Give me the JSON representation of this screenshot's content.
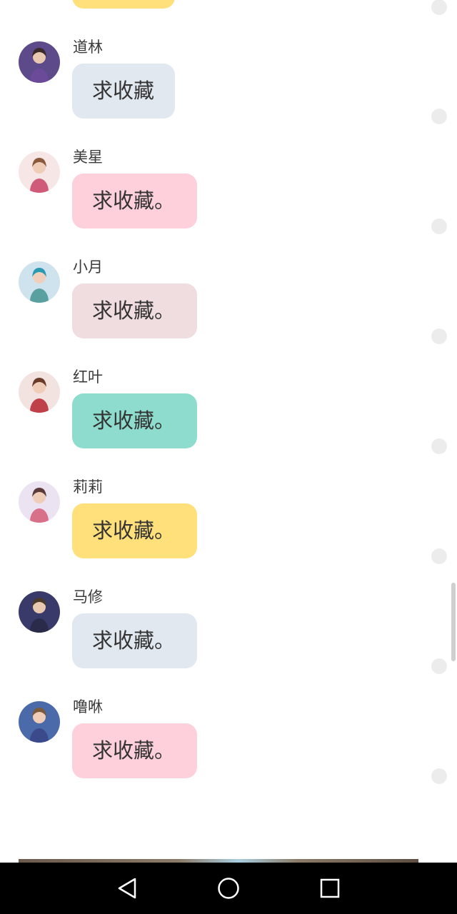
{
  "top_partial": {
    "bubble_color": "#ffe07a"
  },
  "messages": [
    {
      "name": "道林",
      "text": "求收藏",
      "bubble_color": "#e1e8f0",
      "bubble_width": 144,
      "avatar": {
        "bg": "#5c4a8a",
        "skin": "#e8c8b0",
        "hair": "#3a2a2a",
        "cloth": "#6b4a9a"
      }
    },
    {
      "name": "美星",
      "text": "求收藏。",
      "bubble_color": "#fdd0dc",
      "bubble_width": 175,
      "avatar": {
        "bg": "#f7e6e6",
        "skin": "#f0cdb8",
        "hair": "#8a5a3a",
        "cloth": "#d05a7a"
      }
    },
    {
      "name": "小月",
      "text": "求收藏。",
      "bubble_color": "#f0dde0",
      "bubble_width": 175,
      "avatar": {
        "bg": "#cfe3ee",
        "skin": "#f0d0bc",
        "hair": "#2a9ab0",
        "cloth": "#5aa0a0"
      }
    },
    {
      "name": "红叶",
      "text": "求收藏。",
      "bubble_color": "#8ddcce",
      "bubble_width": 175,
      "avatar": {
        "bg": "#f3e3e0",
        "skin": "#efcdb8",
        "hair": "#6a3a2a",
        "cloth": "#c0404a"
      }
    },
    {
      "name": "莉莉",
      "text": "求收藏。",
      "bubble_color": "#ffe07a",
      "bubble_width": 175,
      "avatar": {
        "bg": "#ebe3f2",
        "skin": "#f0cdb8",
        "hair": "#5a3a3a",
        "cloth": "#d8708a"
      }
    },
    {
      "name": "马修",
      "text": "求收藏。",
      "bubble_color": "#e1e8f0",
      "bubble_width": 175,
      "avatar": {
        "bg": "#3a3a6a",
        "skin": "#e8c8b0",
        "hair": "#4a3a2a",
        "cloth": "#2a2a4a"
      }
    },
    {
      "name": "噜咻",
      "text": "求收藏。",
      "bubble_color": "#fdd0dc",
      "bubble_width": 175,
      "avatar": {
        "bg": "#4a6aaa",
        "skin": "#efcdb8",
        "hair": "#7a5a3a",
        "cloth": "#3a4a8a"
      }
    }
  ],
  "navbar": {
    "back_icon": "triangle-back",
    "home_icon": "circle-home",
    "recents_icon": "square-recents"
  }
}
